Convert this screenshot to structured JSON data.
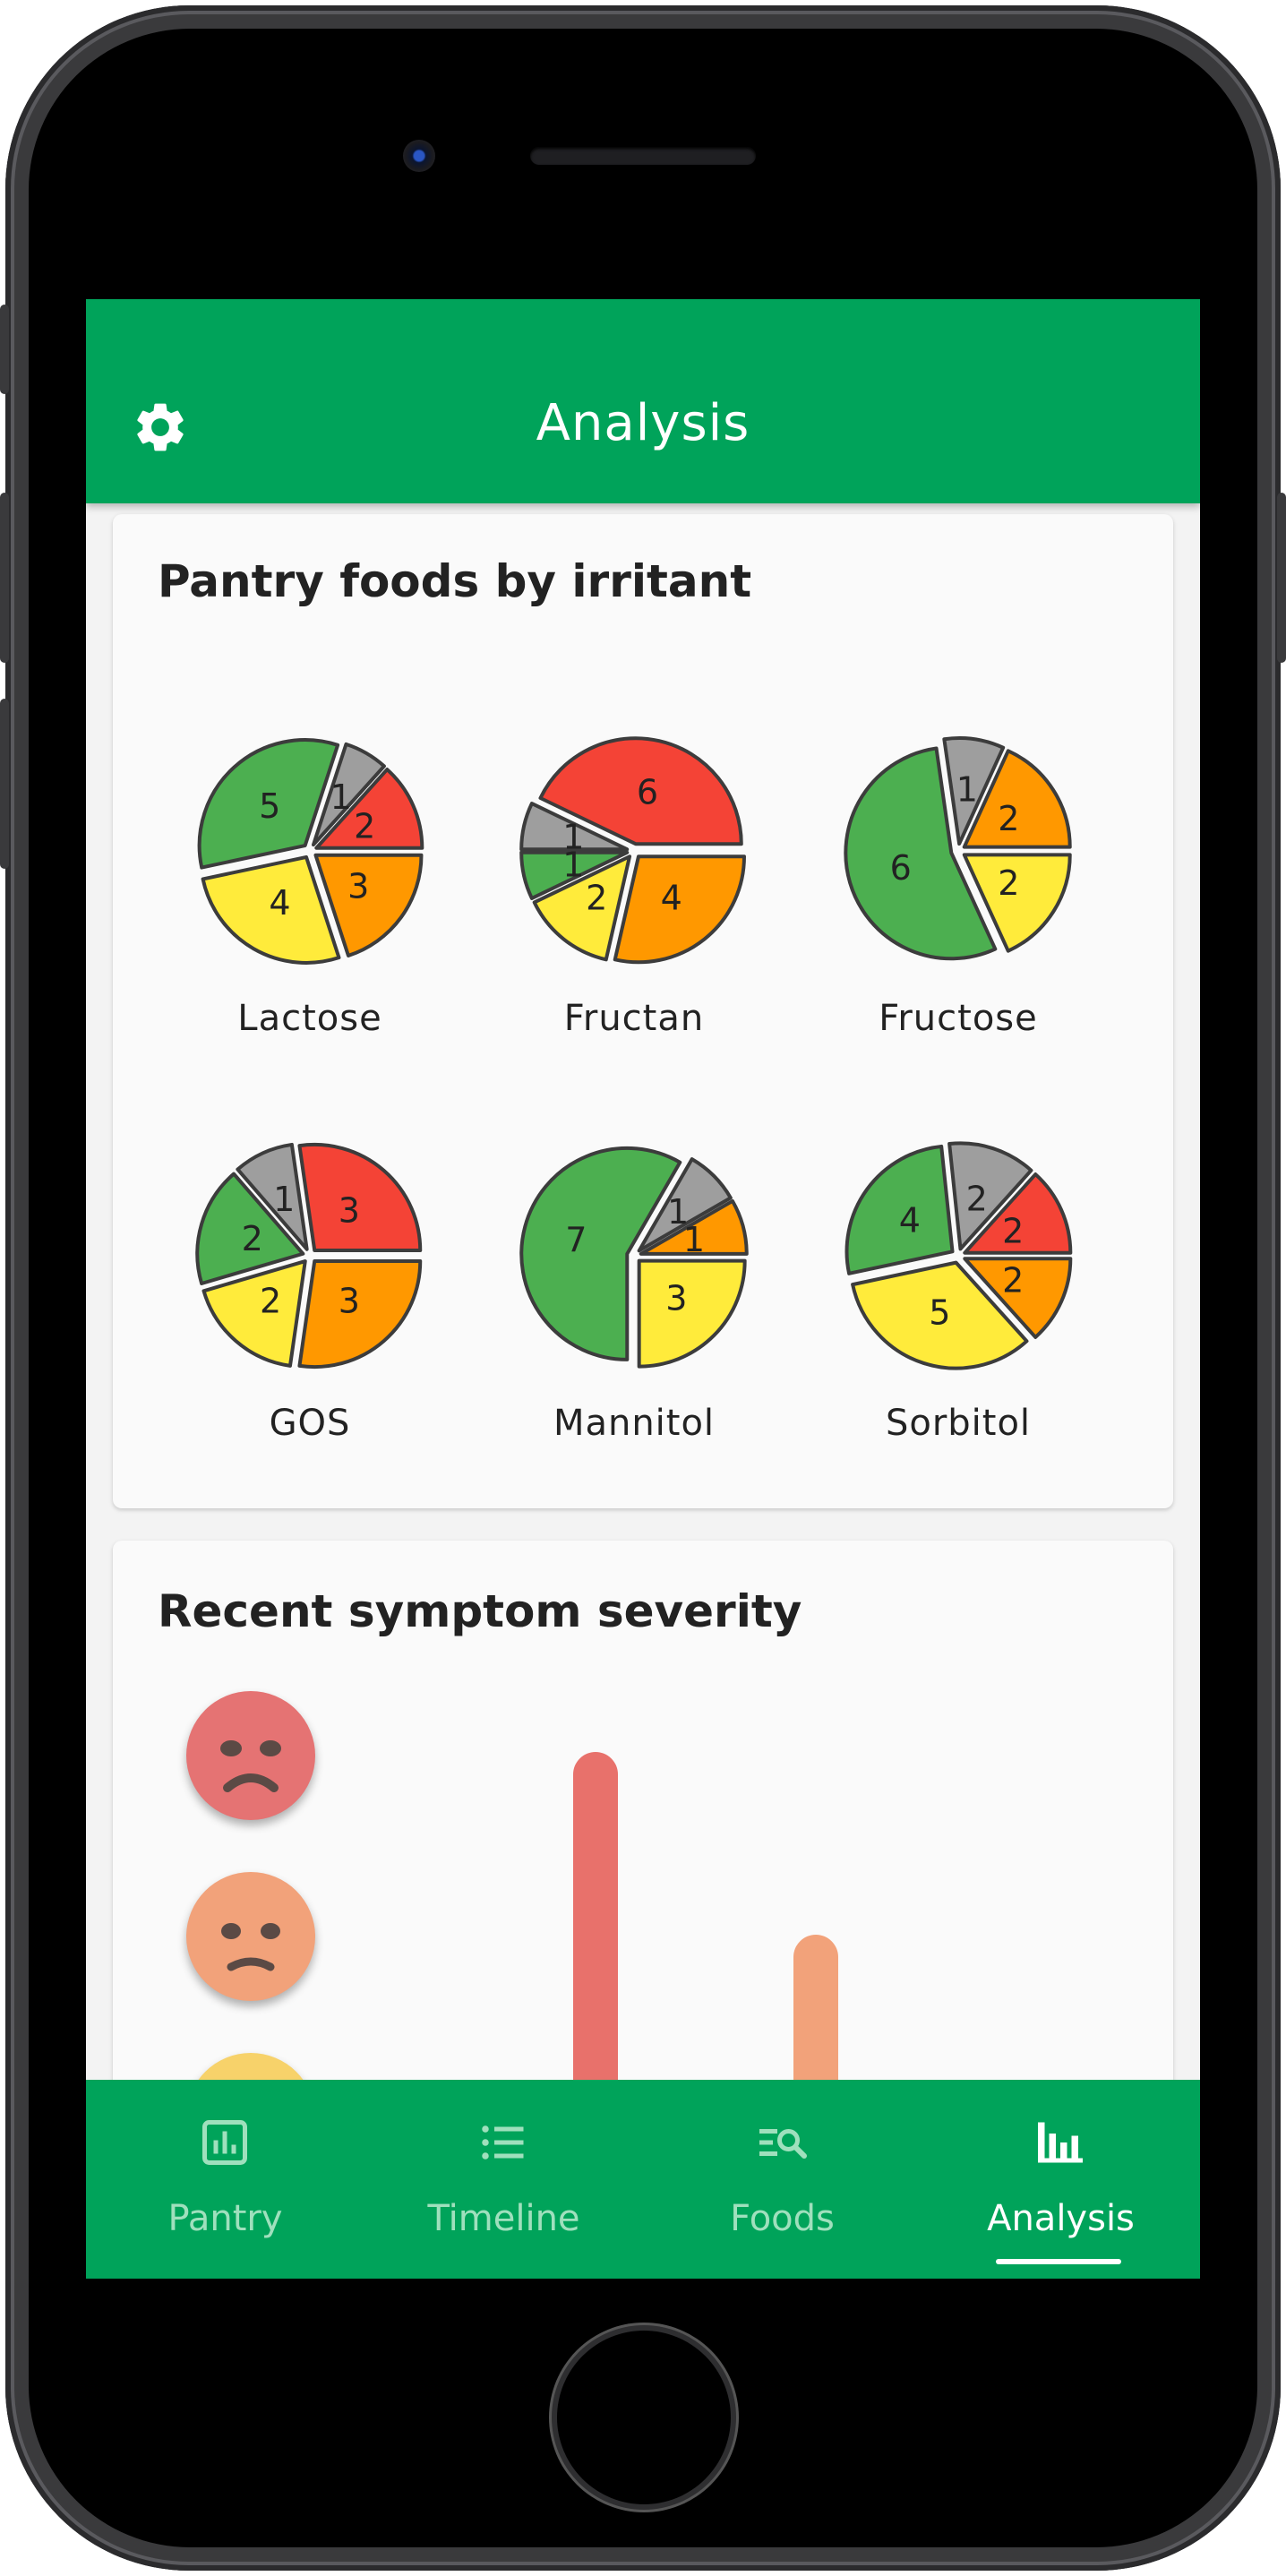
{
  "app_bar": {
    "title": "Analysis",
    "settings_icon": "gear-icon"
  },
  "pantry_card": {
    "title": "Pantry foods by irritant",
    "colors": {
      "red": "#f44336",
      "orange": "#ff9800",
      "yellow": "#ffeb3b",
      "green": "#4caf50",
      "grey": "#9e9e9e"
    }
  },
  "symptom_card": {
    "title": "Recent symptom severity",
    "faces": [
      {
        "icon": "angry-face-icon",
        "color": "#e57373"
      },
      {
        "icon": "sad-face-icon",
        "color": "#f2a27a"
      },
      {
        "icon": "neutral-face-icon",
        "color": "#f7d26a"
      }
    ],
    "bars": [
      {
        "level": "severe",
        "color": "#e8716b"
      },
      {
        "level": "moderate",
        "color": "#f2a27a"
      }
    ]
  },
  "chart_data": [
    {
      "type": "pie",
      "title": "Lactose",
      "series": [
        {
          "label": "red",
          "value": 2
        },
        {
          "label": "grey",
          "value": 1
        },
        {
          "label": "green",
          "value": 5
        },
        {
          "label": "yellow",
          "value": 4
        },
        {
          "label": "orange",
          "value": 3
        }
      ]
    },
    {
      "type": "pie",
      "title": "Fructan",
      "series": [
        {
          "label": "red",
          "value": 6
        },
        {
          "label": "grey",
          "value": 1
        },
        {
          "label": "green",
          "value": 1
        },
        {
          "label": "yellow",
          "value": 2
        },
        {
          "label": "orange",
          "value": 4
        }
      ]
    },
    {
      "type": "pie",
      "title": "Fructose",
      "series": [
        {
          "label": "orange",
          "value": 2
        },
        {
          "label": "grey",
          "value": 1
        },
        {
          "label": "green",
          "value": 6
        },
        {
          "label": "yellow",
          "value": 2
        }
      ]
    },
    {
      "type": "pie",
      "title": "GOS",
      "series": [
        {
          "label": "red",
          "value": 3
        },
        {
          "label": "grey",
          "value": 1
        },
        {
          "label": "green",
          "value": 2
        },
        {
          "label": "yellow",
          "value": 2
        },
        {
          "label": "orange",
          "value": 3
        }
      ]
    },
    {
      "type": "pie",
      "title": "Mannitol",
      "series": [
        {
          "label": "orange",
          "value": 1
        },
        {
          "label": "grey",
          "value": 1
        },
        {
          "label": "green",
          "value": 7
        },
        {
          "label": "yellow",
          "value": 3
        }
      ]
    },
    {
      "type": "pie",
      "title": "Sorbitol",
      "series": [
        {
          "label": "red",
          "value": 2
        },
        {
          "label": "grey",
          "value": 2
        },
        {
          "label": "green",
          "value": 4
        },
        {
          "label": "yellow",
          "value": 5
        },
        {
          "label": "orange",
          "value": 2
        }
      ]
    }
  ],
  "bottom_nav": {
    "items": [
      {
        "label": "Pantry",
        "icon": "pantry-chart-icon",
        "active": false
      },
      {
        "label": "Timeline",
        "icon": "list-icon",
        "active": false
      },
      {
        "label": "Foods",
        "icon": "search-list-icon",
        "active": false
      },
      {
        "label": "Analysis",
        "icon": "bar-chart-icon",
        "active": true
      }
    ]
  }
}
